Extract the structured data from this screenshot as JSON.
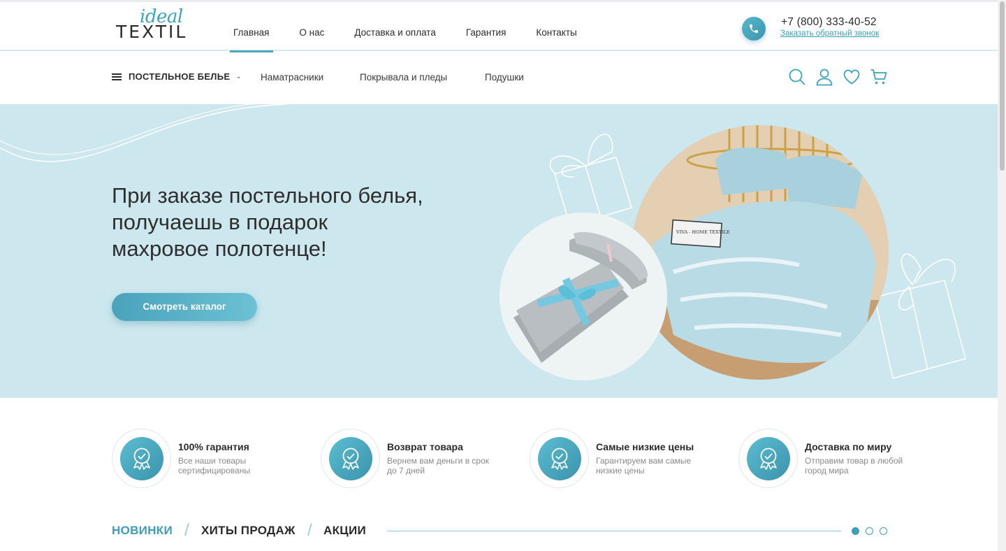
{
  "logo": {
    "script": "ideal",
    "word": "TEXTIL"
  },
  "nav": {
    "items": [
      {
        "label": "Главная",
        "active": true
      },
      {
        "label": "О нас",
        "active": false
      },
      {
        "label": "Доставка и оплата",
        "active": false
      },
      {
        "label": "Гарантия",
        "active": false
      },
      {
        "label": "Контакты",
        "active": false
      }
    ]
  },
  "contact": {
    "phone": "+7 (800) 333-40-52",
    "callback": "Заказать обратный звонок",
    "icon": "phone-icon"
  },
  "catbar": {
    "main": "ПОСТЕЛЬНОЕ БЕЛЬЕ",
    "links": [
      "Наматрасники",
      "Покрывала и пледы",
      "Подушки"
    ],
    "icons": [
      "search-icon",
      "user-icon",
      "heart-icon",
      "cart-icon"
    ]
  },
  "hero": {
    "title_lines": [
      "При заказе постельного белья,",
      "получаешь в подарок",
      "махровое полотенце!"
    ],
    "button": "Смотреть каталог",
    "pillow_tag": "VIVA - HOME TEXTILE"
  },
  "features": [
    {
      "title": "100% гарантия",
      "text": "Все наши товары сертифицированы"
    },
    {
      "title": "Возврат товара",
      "text": "Вернем вам деньги в срок до 7 дней"
    },
    {
      "title": "Самые низкие цены",
      "text": "Гарантируем вам самые низкие цены"
    },
    {
      "title": "Доставка по миру",
      "text": "Отправим товар в любой город мира"
    }
  ],
  "tabs": {
    "items": [
      "НОВИНКИ",
      "ХИТЫ ПРОДАЖ",
      "АКЦИИ"
    ],
    "active": 0,
    "separator": "/"
  },
  "slider": {
    "pages": 3,
    "current": 1
  },
  "colors": {
    "accent": "#3b9fb8",
    "hero_bg": "#cde7ee"
  }
}
